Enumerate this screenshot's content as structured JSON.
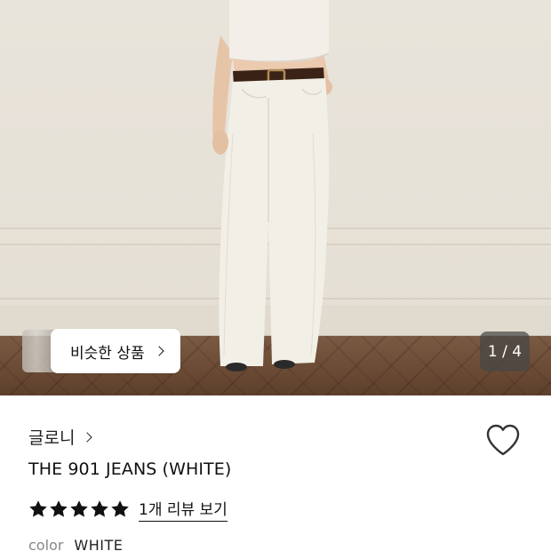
{
  "gallery": {
    "current_page": "1",
    "total_pages": "4",
    "page_indicator": "1 / 4",
    "similar_products_label": "비슷한 상품"
  },
  "product": {
    "brand": "글로니",
    "title": "THE 901 JEANS (WHITE)",
    "rating": 5,
    "rating_max": 5,
    "review_link": "1개 리뷰 보기",
    "option_label": "color",
    "option_value": "WHITE"
  },
  "icons": {
    "wishlist": "heart-outline-icon",
    "brand_chevron": "chevron-right-icon",
    "similar_chevron": "chevron-right-icon",
    "star": "star-filled-icon"
  },
  "colors": {
    "text": "#111111",
    "indicator_bg": "#464646",
    "star": "#111111"
  }
}
